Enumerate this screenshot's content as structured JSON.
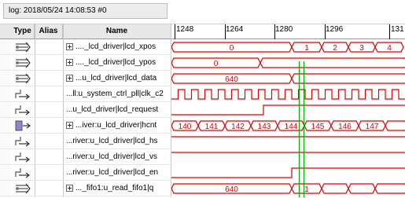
{
  "log": {
    "text": "log: 2018/05/24 14:08:53  #0"
  },
  "columns": {
    "type": "Type",
    "alias": "Alias",
    "name": "Name"
  },
  "ruler": {
    "ticks": [
      "1248",
      "1264",
      "1280",
      "1296",
      "131"
    ]
  },
  "signals": [
    {
      "name": "...._lcd_driver|lcd_xpos",
      "type": "bus-icon",
      "expandable": true,
      "values": [
        "0",
        "1",
        "2",
        "3",
        "4"
      ]
    },
    {
      "name": "...._lcd_driver|lcd_ypos",
      "type": "bus-icon",
      "expandable": true,
      "values": [
        "0"
      ]
    },
    {
      "name": "...u_lcd_driver|lcd_data",
      "type": "bus-icon",
      "expandable": true,
      "values": [
        "640"
      ]
    },
    {
      "name": "...ll:u_system_ctrl_pll|clk_c2",
      "type": "clock-icon",
      "expandable": false,
      "values": []
    },
    {
      "name": "...u_lcd_driver|lcd_request",
      "type": "clock-icon",
      "expandable": false,
      "values": []
    },
    {
      "name": "...iver:u_lcd_driver|hcnt",
      "type": "counter-icon",
      "expandable": true,
      "values": [
        "140",
        "141",
        "142",
        "143",
        "144",
        "145",
        "146",
        "147"
      ]
    },
    {
      "name": "...river:u_lcd_driver|lcd_hs",
      "type": "clock-icon",
      "expandable": false,
      "values": []
    },
    {
      "name": "...river:u_lcd_driver|lcd_vs",
      "type": "clock-icon",
      "expandable": false,
      "values": []
    },
    {
      "name": "...river:u_lcd_driver|lcd_en",
      "type": "clock-icon",
      "expandable": false,
      "values": []
    },
    {
      "name": "..._fifo1:u_read_fifo1|q",
      "type": "bus-icon",
      "expandable": true,
      "values": [
        "640",
        "1"
      ]
    }
  ],
  "colors": {
    "waveform": "#e00000",
    "cursor": "#00b000",
    "grid": "#000000"
  }
}
